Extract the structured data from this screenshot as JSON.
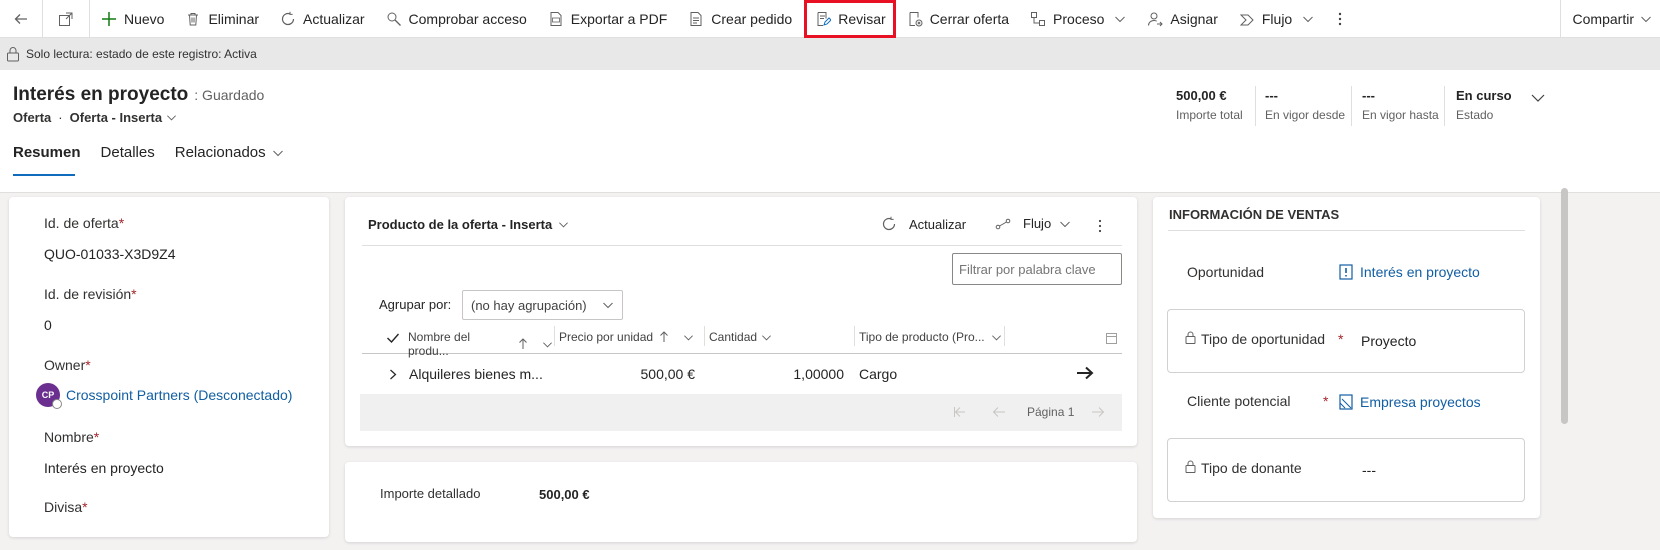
{
  "commandbar": {
    "new": "Nuevo",
    "delete": "Eliminar",
    "refresh": "Actualizar",
    "check_access": "Comprobar acceso",
    "export_pdf": "Exportar a PDF",
    "create_order": "Crear pedido",
    "revise": "Revisar",
    "close_quote": "Cerrar oferta",
    "process": "Proceso",
    "assign": "Asignar",
    "flow": "Flujo",
    "share": "Compartir"
  },
  "readonly_notice": "Solo lectura: estado de este registro: Activa",
  "record": {
    "title": "Interés en proyecto",
    "save_status": ": Guardado",
    "entity": "Oferta",
    "form": "Oferta - Inserta"
  },
  "header_fields": [
    {
      "value": "500,00 €",
      "label": "Importe total"
    },
    {
      "value": "---",
      "label": "En vigor desde"
    },
    {
      "value": "---",
      "label": "En vigor hasta"
    },
    {
      "value": "En curso",
      "label": "Estado"
    }
  ],
  "tabs": [
    "Resumen",
    "Detalles",
    "Relacionados"
  ],
  "left_form": {
    "quote_id_label": "Id. de oferta",
    "quote_id_value": "QUO-01033-X3D9Z4",
    "revision_label": "Id. de revisión",
    "revision_value": "0",
    "owner_label": "Owner",
    "owner_initials": "CP",
    "owner_value": "Crosspoint Partners (Desconectado)",
    "name_label": "Nombre",
    "name_value": "Interés en proyecto",
    "currency_label": "Divisa"
  },
  "products": {
    "title": "Producto de la oferta - Inserta",
    "refresh": "Actualizar",
    "flow": "Flujo",
    "filter_placeholder": "Filtrar por palabra clave",
    "group_by_label": "Agrupar por:",
    "group_by_value": "(no hay agrupación)",
    "columns": [
      "Nombre del produ...",
      "Precio por unidad",
      "Cantidad",
      "Tipo de producto (Pro..."
    ],
    "rows": [
      {
        "name": "Alquileres bienes m...",
        "price": "500,00 €",
        "qty": "1,00000",
        "type": "Cargo"
      }
    ],
    "page": "Página 1"
  },
  "summary": {
    "detailed_amount_label": "Importe detallado",
    "detailed_amount_value": "500,00 €"
  },
  "sales_info": {
    "title": "INFORMACIÓN DE VENTAS",
    "opportunity_label": "Oportunidad",
    "opportunity_value": "Interés en proyecto",
    "opp_type_label": "Tipo de oportunidad",
    "opp_type_value": "Proyecto",
    "customer_label": "Cliente potencial",
    "customer_value": "Empresa proyectos",
    "donor_type_label": "Tipo de donante",
    "donor_type_value": "---"
  },
  "colors": {
    "accent": "#0f6cbd",
    "link": "#115ea3",
    "required": "#a4262c",
    "highlight": "#e81123",
    "avatar": "#6b2f8f"
  }
}
